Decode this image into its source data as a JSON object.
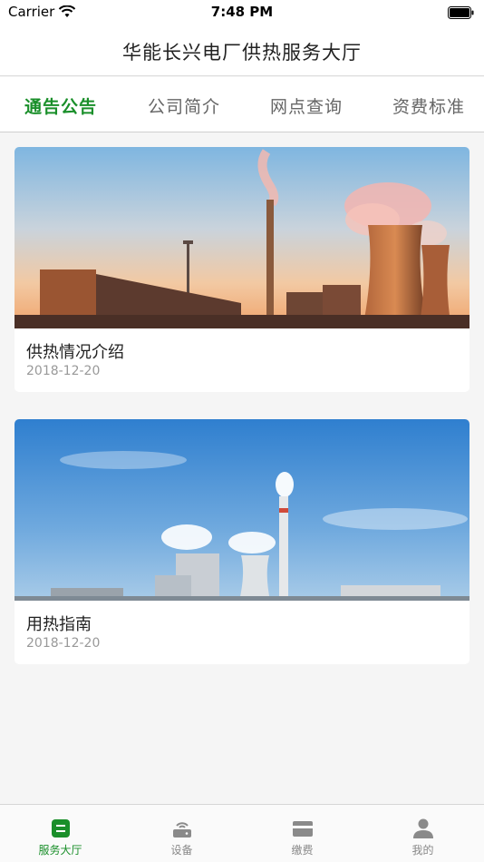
{
  "status": {
    "carrier": "Carrier",
    "time": "7:48 PM"
  },
  "nav": {
    "title": "华能长兴电厂供热服务大厅"
  },
  "tabs": [
    {
      "label": "通告公告",
      "active": true
    },
    {
      "label": "公司简介",
      "active": false
    },
    {
      "label": "网点查询",
      "active": false
    },
    {
      "label": "资费标准",
      "active": false
    }
  ],
  "articles": [
    {
      "title": "供热情况介绍",
      "date": "2018-12-20",
      "image": "power-plant-sunset"
    },
    {
      "title": "用热指南",
      "date": "2018-12-20",
      "image": "power-plant-blue-sky"
    }
  ],
  "tabbar": [
    {
      "label": "服务大厅",
      "icon": "service-hall-icon",
      "active": true
    },
    {
      "label": "设备",
      "icon": "router-device-icon",
      "active": false
    },
    {
      "label": "缴费",
      "icon": "card-payment-icon",
      "active": false
    },
    {
      "label": "我的",
      "icon": "user-profile-icon",
      "active": false
    }
  ],
  "colors": {
    "accent": "#1a8f2a",
    "inactive": "#888888",
    "background": "#f5f5f5"
  }
}
